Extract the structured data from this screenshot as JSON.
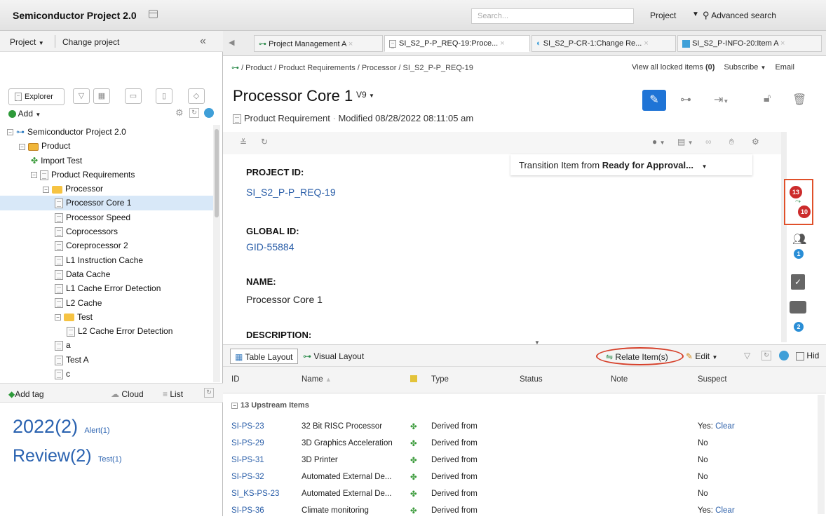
{
  "app": {
    "title": "Semiconductor Project 2.0"
  },
  "search": {
    "placeholder": "Search...",
    "project_label": "Project",
    "advanced": "Advanced search"
  },
  "left": {
    "project_menu": "Project",
    "change_project": "Change project",
    "explorer_tab": "Explorer",
    "add_label": "Add",
    "tree": [
      {
        "label": "Semiconductor Project 2.0",
        "level": 0,
        "kind": "project"
      },
      {
        "label": "Product",
        "level": 1,
        "kind": "component"
      },
      {
        "label": "Import Test",
        "level": 2,
        "kind": "puzzle"
      },
      {
        "label": "Product Requirements",
        "level": 2,
        "kind": "set"
      },
      {
        "label": "Processor",
        "level": 3,
        "kind": "folder"
      },
      {
        "label": "Processor Core 1",
        "level": 4,
        "kind": "doc",
        "selected": true
      },
      {
        "label": "Processor Speed",
        "level": 4,
        "kind": "doc"
      },
      {
        "label": "Coprocessors",
        "level": 4,
        "kind": "doc"
      },
      {
        "label": "Coreprocessor 2",
        "level": 4,
        "kind": "doc"
      },
      {
        "label": "L1 Instruction Cache",
        "level": 4,
        "kind": "doc"
      },
      {
        "label": "Data Cache",
        "level": 4,
        "kind": "doc"
      },
      {
        "label": "L1 Cache Error Detection",
        "level": 4,
        "kind": "doc"
      },
      {
        "label": "L2 Cache",
        "level": 4,
        "kind": "doc"
      },
      {
        "label": "Test",
        "level": 4,
        "kind": "folder"
      },
      {
        "label": "L2 Cache Error Detection",
        "level": 5,
        "kind": "doc"
      },
      {
        "label": "a",
        "level": 4,
        "kind": "doc"
      },
      {
        "label": "Test A",
        "level": 4,
        "kind": "doc"
      },
      {
        "label": "c",
        "level": 4,
        "kind": "doc"
      }
    ],
    "add_tag": "Add tag",
    "cloud": "Cloud",
    "list": "List",
    "tags": [
      {
        "big": "2022(2)",
        "small": "Alert(1)"
      },
      {
        "big": "Review(2)",
        "small": "Test(1)"
      }
    ]
  },
  "tabs": [
    {
      "label": "Project Management A"
    },
    {
      "label": "SI_S2_P-P_REQ-19:Proce..."
    },
    {
      "label": "SI_S2_P-CR-1:Change Re..."
    },
    {
      "label": "SI_S2_P-INFO-20:Item A"
    }
  ],
  "breadcrumb": "/ Product / Product Requirements / Processor / SI_S2_P-P_REQ-19",
  "header_links": {
    "locked_prefix": "View all locked items ",
    "locked_count": "(0)",
    "subscribe": "Subscribe",
    "email": "Email"
  },
  "item": {
    "title": "Processor Core 1",
    "version": "V9",
    "type": "Product Requirement",
    "modified": "Modified 08/28/2022 08:11:05 am",
    "transition_prefix": "Transition Item from ",
    "transition_state": "Ready for Approval...",
    "fields": [
      {
        "label": "PROJECT ID:",
        "value": "SI_S2_P-P_REQ-19",
        "link": true
      },
      {
        "label": "GLOBAL ID:",
        "value": "GID-55884",
        "link": true
      },
      {
        "label": "NAME:",
        "value": "Processor Core 1",
        "link": false
      },
      {
        "label": "DESCRIPTION:",
        "value": "",
        "link": false
      }
    ]
  },
  "rail": {
    "relationships_up": "13",
    "relationships_down": "10",
    "reviewers": "1",
    "comments": "2"
  },
  "grid": {
    "table_layout": "Table Layout",
    "visual_layout": "Visual Layout",
    "relate": "Relate Item(s)",
    "edit": "Edit",
    "hide": "Hid",
    "columns": [
      "ID",
      "Name",
      "",
      "Type",
      "Status",
      "Note",
      "Suspect"
    ],
    "group": "13 Upstream Items",
    "rows": [
      {
        "id": "SI-PS-23",
        "name": "32 Bit RISC Processor",
        "type": "Derived from",
        "status": "",
        "note": "",
        "suspect": "Yes:",
        "clear": "Clear"
      },
      {
        "id": "SI-PS-29",
        "name": "3D Graphics Acceleration",
        "type": "Derived from",
        "status": "",
        "note": "",
        "suspect": "No",
        "clear": ""
      },
      {
        "id": "SI-PS-31",
        "name": "3D Printer",
        "type": "Derived from",
        "status": "",
        "note": "",
        "suspect": "No",
        "clear": ""
      },
      {
        "id": "SI-PS-32",
        "name": "Automated External De...",
        "type": "Derived from",
        "status": "",
        "note": "",
        "suspect": "No",
        "clear": ""
      },
      {
        "id": "SI_KS-PS-23",
        "name": "Automated External De...",
        "type": "Derived from",
        "status": "",
        "note": "",
        "suspect": "No",
        "clear": ""
      },
      {
        "id": "SI-PS-36",
        "name": "Climate monitoring",
        "type": "Derived from",
        "status": "",
        "note": "",
        "suspect": "Yes:",
        "clear": "Clear"
      }
    ]
  },
  "colors": {
    "accent": "#1f74d6",
    "link": "#2a5ea8",
    "highlight": "#d8e8f8",
    "alert": "#cc2b2b"
  }
}
